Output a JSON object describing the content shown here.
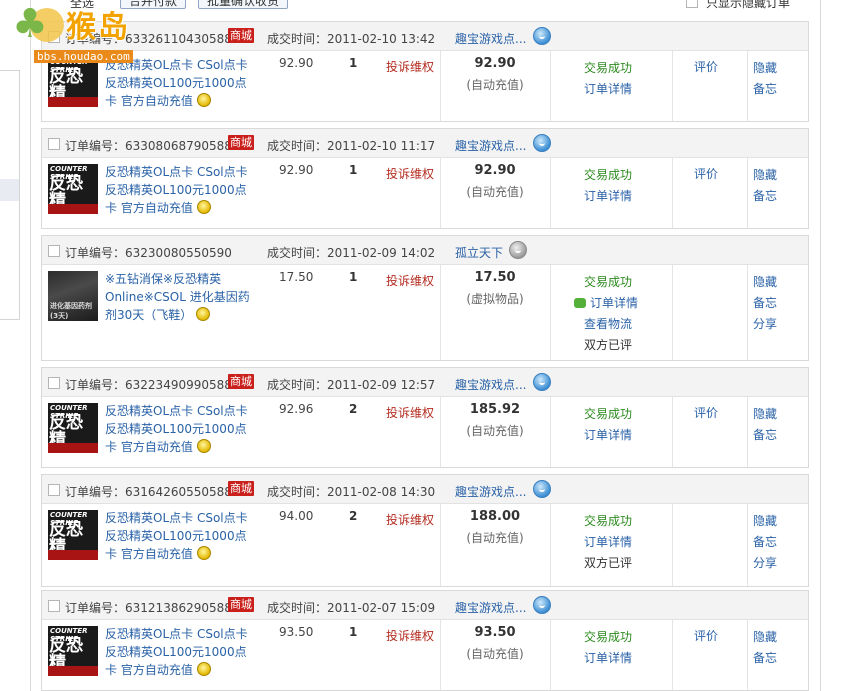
{
  "watermark": {
    "brand": "猴岛",
    "site": "bbs.houdao.com"
  },
  "toolbar": {
    "select_all": "全选",
    "merge_pay": "合并付款",
    "batch_confirm": "批量确认收货",
    "show_hidden": "只显示隐藏订单"
  },
  "labels": {
    "order_no": "订单编号：",
    "deal_time": "成交时间：",
    "mall_badge": "商城",
    "complain": "投诉维权"
  },
  "orders": [
    {
      "order_no": "63326110430588",
      "mall": true,
      "deal_time": "2011-02-10 13:42",
      "seller": "趣宝游戏点...",
      "thumb_title": "COUNTER STRIKE",
      "thumb_cn": "反恐精",
      "title": "反恐精英OL点卡 CSol点卡 反恐精英OL100元1000点卡 官方自动充值",
      "price": "92.90",
      "qty": "1",
      "total": "92.90",
      "total_note": "(自动充值)",
      "status": [
        "交易成功",
        "订单详情"
      ],
      "rate": "评价",
      "actions": [
        "隐藏",
        "备忘"
      ]
    },
    {
      "order_no": "63308068790588",
      "mall": true,
      "deal_time": "2011-02-10 11:17",
      "seller": "趣宝游戏点...",
      "thumb_title": "COUNTER STRIKE",
      "thumb_cn": "反恐精",
      "title": "反恐精英OL点卡 CSol点卡 反恐精英OL100元1000点卡 官方自动充值",
      "price": "92.90",
      "qty": "1",
      "total": "92.90",
      "total_note": "(自动充值)",
      "status": [
        "交易成功",
        "订单详情"
      ],
      "rate": "评价",
      "actions": [
        "隐藏",
        "备忘"
      ]
    },
    {
      "order_no": "63230080550590",
      "mall": false,
      "deal_time": "2011-02-09 14:02",
      "seller": "孤立天下",
      "thumb_title": "进化基因药剂(3天)",
      "thumb_cn": "",
      "title": "※五钻消保※反恐精英Online※CSOL 进化基因药剂30天（飞鞋）",
      "price": "17.50",
      "qty": "1",
      "total": "17.50",
      "total_note": "(虚拟物品)",
      "status": [
        "交易成功",
        "订单详情",
        "查看物流",
        "双方已评"
      ],
      "rate": "",
      "actions": [
        "隐藏",
        "备忘",
        "分享"
      ]
    },
    {
      "order_no": "63223490990588",
      "mall": true,
      "deal_time": "2011-02-09 12:57",
      "seller": "趣宝游戏点...",
      "thumb_title": "COUNTER STRIKE",
      "thumb_cn": "反恐精",
      "title": "反恐精英OL点卡 CSol点卡 反恐精英OL100元1000点卡 官方自动充值",
      "price": "92.96",
      "qty": "2",
      "total": "185.92",
      "total_note": "(自动充值)",
      "status": [
        "交易成功",
        "订单详情"
      ],
      "rate": "评价",
      "actions": [
        "隐藏",
        "备忘"
      ]
    },
    {
      "order_no": "63164260550588",
      "mall": true,
      "deal_time": "2011-02-08 14:30",
      "seller": "趣宝游戏点...",
      "thumb_title": "COUNTER STRIKE",
      "thumb_cn": "反恐精",
      "title": "反恐精英OL点卡 CSol点卡 反恐精英OL100元1000点卡 官方自动充值",
      "price": "94.00",
      "qty": "2",
      "total": "188.00",
      "total_note": "(自动充值)",
      "status": [
        "交易成功",
        "订单详情",
        "双方已评"
      ],
      "rate": "",
      "actions": [
        "隐藏",
        "备忘",
        "分享"
      ]
    },
    {
      "order_no": "63121386290588",
      "mall": true,
      "deal_time": "2011-02-07 15:09",
      "seller": "趣宝游戏点...",
      "thumb_title": "COUNTER STRIKE",
      "thumb_cn": "反恐精",
      "title": "反恐精英OL点卡 CSol点卡 反恐精英OL100元1000点卡 官方自动充值",
      "price": "93.50",
      "qty": "1",
      "total": "93.50",
      "total_note": "(自动充值)",
      "status": [
        "交易成功",
        "订单详情"
      ],
      "rate": "评价",
      "actions": [
        "隐藏",
        "备忘"
      ]
    }
  ]
}
